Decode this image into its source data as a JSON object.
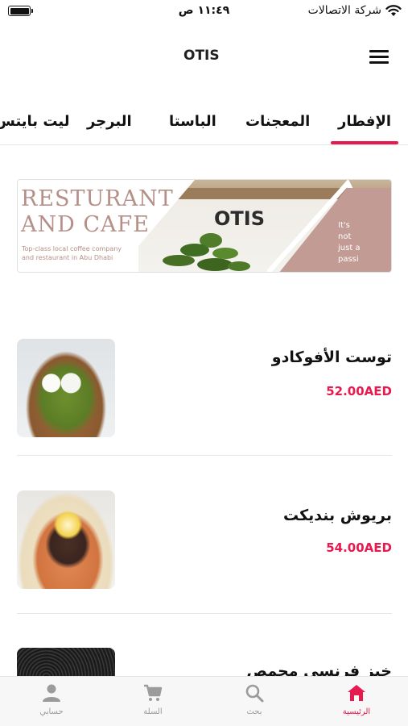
{
  "status_bar": {
    "carrier": "شركة الاتصالات",
    "time": "١١:٤٩ ص",
    "battery_level": 1.0
  },
  "header": {
    "logo": "OTIS",
    "menu_icon": "hamburger-menu-icon"
  },
  "tabs": [
    {
      "label": "الإفطار",
      "active": true
    },
    {
      "label": "المعجنات",
      "active": false
    },
    {
      "label": "الباستا",
      "active": false
    },
    {
      "label": "البرجر",
      "active": false
    },
    {
      "label": "ليت بايتس",
      "active": false
    }
  ],
  "banner": {
    "title": "RESTURANT\nAND CAFE",
    "subtitle": "Top-class local coffee company\nand restaurant in Abu Dhabi",
    "logo": "OTIS",
    "tagline": "It's\nnot\njust a\npassi"
  },
  "menu_items": [
    {
      "name": "توست الأفوكادو",
      "price": "52.00AED"
    },
    {
      "name": "بريوش بنديكت",
      "price": "54.00AED"
    },
    {
      "name": "خبز فرنسي محمص",
      "price": ""
    }
  ],
  "bottom_nav": [
    {
      "label": "الرئيسية",
      "icon": "home-icon",
      "active": true
    },
    {
      "label": "بحث",
      "icon": "search-icon",
      "active": false
    },
    {
      "label": "السلة",
      "icon": "cart-icon",
      "active": false
    },
    {
      "label": "حسابي",
      "icon": "account-icon",
      "active": false
    }
  ],
  "colors": {
    "accent": "#e8194e",
    "banner_pink": "#c19b94",
    "nav_inactive": "#9b9b9b"
  }
}
